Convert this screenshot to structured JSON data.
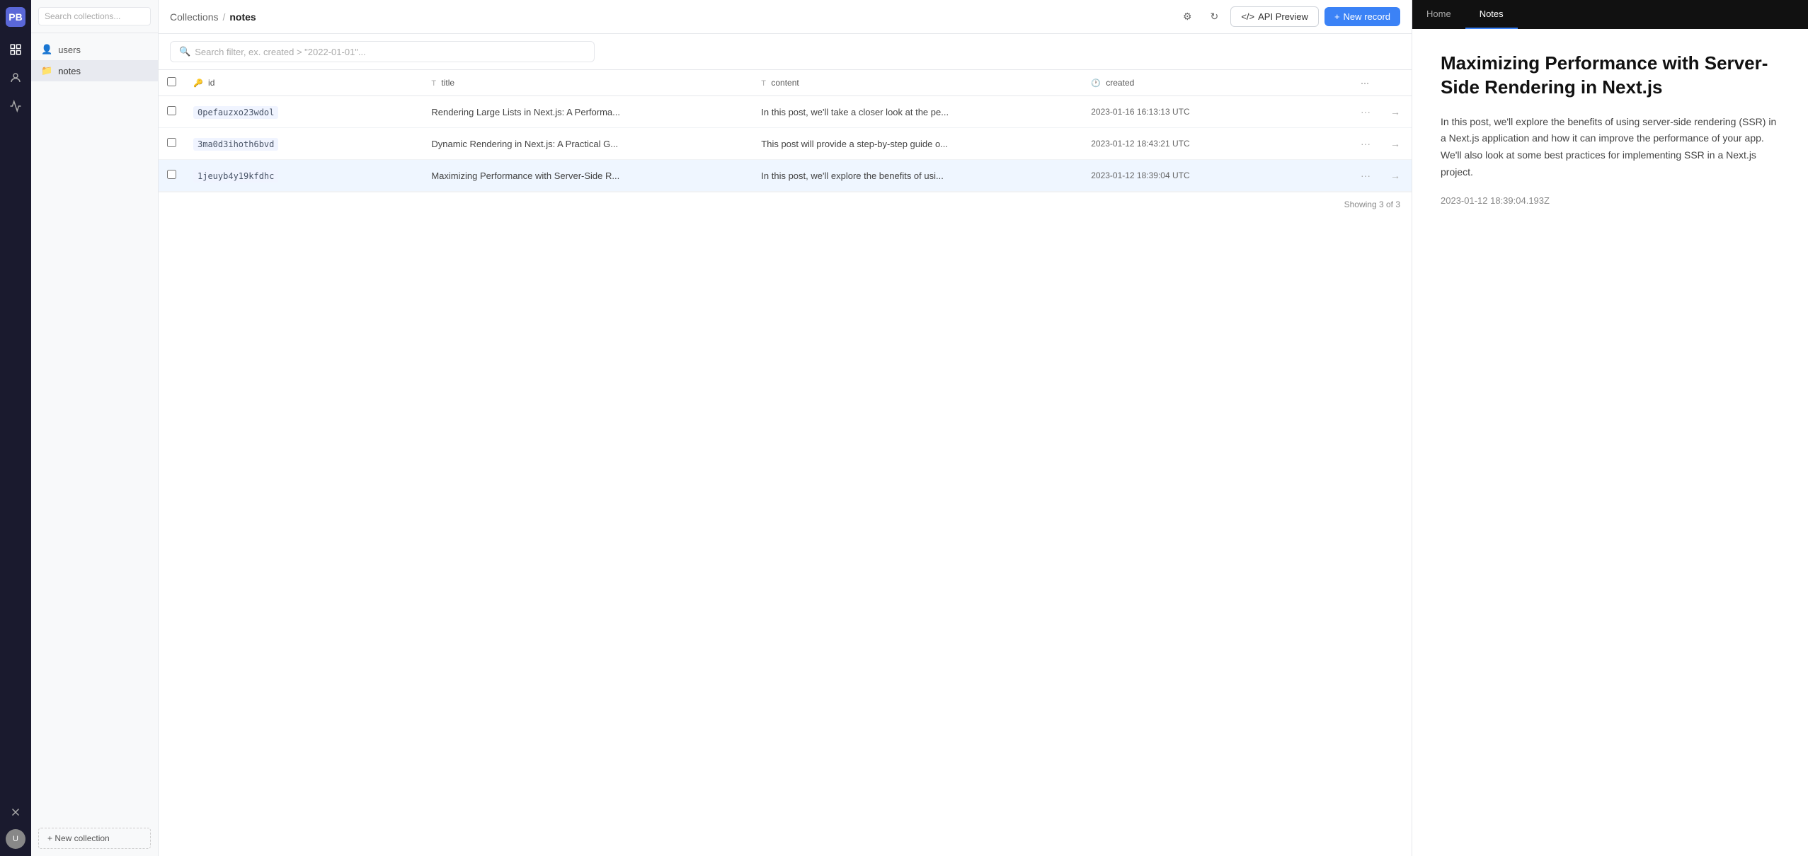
{
  "app": {
    "logo": "PB",
    "icons": [
      "collections",
      "users",
      "analytics",
      "close"
    ]
  },
  "sidebar": {
    "search_placeholder": "Search collections...",
    "collections": [
      {
        "id": "users",
        "label": "users",
        "icon": "👤"
      },
      {
        "id": "notes",
        "label": "notes",
        "icon": "📁"
      }
    ],
    "new_collection_label": "+ New collection"
  },
  "header": {
    "breadcrumb_root": "Collections",
    "breadcrumb_sep": "/",
    "breadcrumb_current": "notes",
    "api_preview_label": "API Preview",
    "new_record_label": "+ New record"
  },
  "filter": {
    "placeholder": "Search filter, ex. created > \"2022-01-01\"..."
  },
  "table": {
    "columns": [
      {
        "id": "id",
        "type": "🔑",
        "label": "id"
      },
      {
        "id": "title",
        "type": "T",
        "label": "title"
      },
      {
        "id": "content",
        "type": "T",
        "label": "content"
      },
      {
        "id": "created",
        "type": "🕐",
        "label": "created"
      }
    ],
    "rows": [
      {
        "id": "0pefauzxo23wdol",
        "title": "Rendering Large Lists in Next.js: A Performa...",
        "content": "In this post, we'll take a closer look at the pe...",
        "created": "2023-01-16 16:13:13 UTC"
      },
      {
        "id": "3ma0d3ihoth6bvd",
        "title": "Dynamic Rendering in Next.js: A Practical G...",
        "content": "This post will provide a step-by-step guide o...",
        "created": "2023-01-12 18:43:21 UTC"
      },
      {
        "id": "1jeuyb4y19kfdhc",
        "title": "Maximizing Performance with Server-Side R...",
        "content": "In this post, we'll explore the benefits of usi...",
        "created": "2023-01-12 18:39:04 UTC"
      }
    ],
    "showing": "Showing 3 of 3"
  },
  "right_panel": {
    "tabs": [
      {
        "id": "home",
        "label": "Home"
      },
      {
        "id": "notes",
        "label": "Notes"
      }
    ],
    "active_tab": "notes",
    "record": {
      "title": "Maximizing Performance with Server-Side Rendering in Next.js",
      "body": "In this post, we'll explore the benefits of using server-side rendering (SSR) in a Next.js application and how it can improve the performance of your app. We'll also look at some best practices for implementing SSR in a Next.js project.",
      "date": "2023-01-12 18:39:04.193Z"
    }
  }
}
